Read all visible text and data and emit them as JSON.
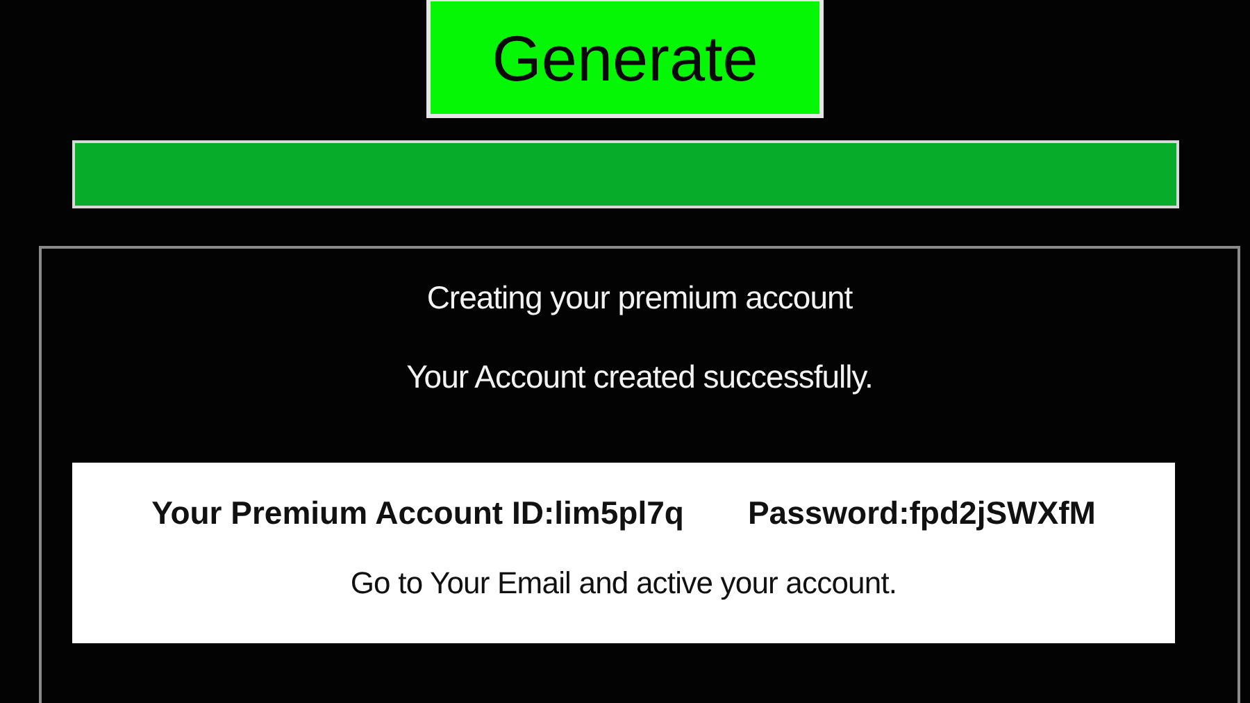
{
  "generate_button": {
    "label": "Generate"
  },
  "progress": {
    "level": 1
  },
  "status_lines": [
    "Creating your premium account",
    "Your Account created successfully."
  ],
  "result": {
    "account_id": "Your Premium Account ID:lim5pl7q",
    "password": "Password:fpd2jSWXfM",
    "note": "Go to Your Email and active your account."
  }
}
